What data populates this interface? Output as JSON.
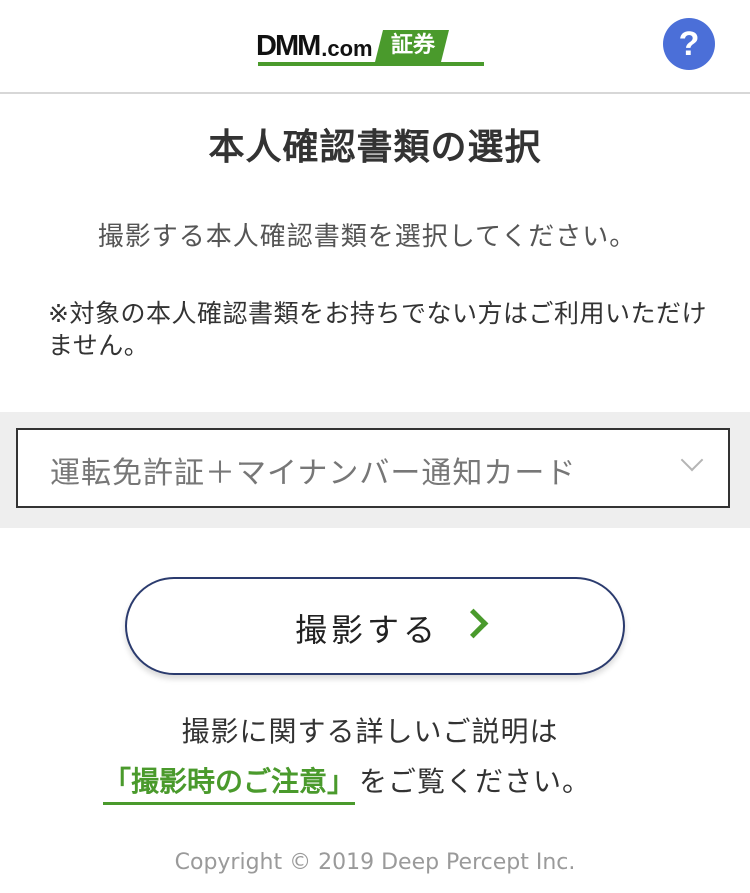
{
  "header": {
    "logo": {
      "dmm": "DMM",
      "com": ".com",
      "badge": "証券"
    },
    "help_icon": "?"
  },
  "colors": {
    "brand_green": "#4a9a2c",
    "help_blue": "#4b6fd8",
    "button_border": "#2b3b6e"
  },
  "main": {
    "title": "本人確認書類の選択",
    "instruction": "撮影する本人確認書類を選択してください。",
    "note": "※対象の本人確認書類をお持ちでない方はご利用いただけません。",
    "select": {
      "value": "運転免許証＋マイナンバー通知カード"
    },
    "shoot_button": {
      "label": "撮影する"
    },
    "explain_line1": "撮影に関する詳しいご説明は",
    "notice_link": "「撮影時のご注意」",
    "explain_line2_rest": "をご覧ください。"
  },
  "footer": {
    "copyright": "Copyright © 2019 Deep Percept Inc."
  }
}
